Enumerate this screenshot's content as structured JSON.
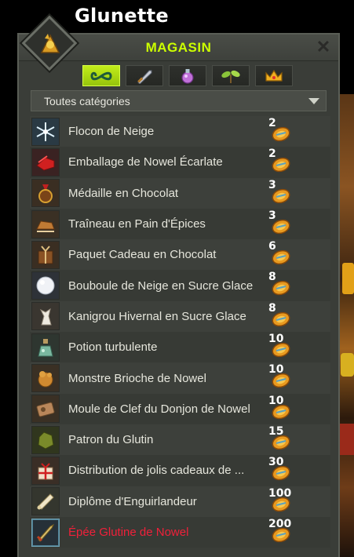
{
  "character": {
    "name": "Glunette"
  },
  "window": {
    "title": "MAGASIN",
    "close_label": "✕",
    "tabs": [
      {
        "icon": "infinity-icon",
        "active": true
      },
      {
        "icon": "sword-icon",
        "active": false
      },
      {
        "icon": "potion-icon",
        "active": false
      },
      {
        "icon": "plant-icon",
        "active": false
      },
      {
        "icon": "crown-icon",
        "active": false
      }
    ],
    "category_select": {
      "value": "Toutes catégories"
    }
  },
  "items": [
    {
      "name": "Flocon de Neige",
      "price": "2",
      "icon": "snowflake-icon"
    },
    {
      "name": "Emballage de Nowel Écarlate",
      "price": "2",
      "icon": "red-wrapping-icon"
    },
    {
      "name": "Médaille en Chocolat",
      "price": "3",
      "icon": "chocolate-medal-icon"
    },
    {
      "name": "Traîneau en Pain d'Épices",
      "price": "3",
      "icon": "gingerbread-sled-icon"
    },
    {
      "name": "Paquet Cadeau en Chocolat",
      "price": "6",
      "icon": "chocolate-gift-icon"
    },
    {
      "name": "Bouboule de Neige en Sucre Glace",
      "price": "8",
      "icon": "snowball-icon"
    },
    {
      "name": "Kanigrou Hivernal en Sucre Glace",
      "price": "8",
      "icon": "sugar-kanigrou-icon"
    },
    {
      "name": "Potion turbulente",
      "price": "10",
      "icon": "potion-icon"
    },
    {
      "name": "Monstre Brioche de Nowel",
      "price": "10",
      "icon": "brioche-monster-icon"
    },
    {
      "name": "Moule de Clef du Donjon de Nowel",
      "price": "10",
      "icon": "key-mold-icon"
    },
    {
      "name": "Patron du Glutin",
      "price": "15",
      "icon": "pattern-icon"
    },
    {
      "name": "Distribution de jolis cadeaux de ...",
      "price": "30",
      "icon": "gift-box-icon"
    },
    {
      "name": "Diplôme d'Enguirlandeur",
      "price": "100",
      "icon": "diploma-scroll-icon"
    },
    {
      "name": "Épée Glutine de Nowel",
      "price": "200",
      "icon": "sword-icon",
      "selected": true
    }
  ],
  "colors": {
    "title": "#ccff00",
    "selected_item": "#f0203a",
    "active_tab": "#b0dc14"
  }
}
